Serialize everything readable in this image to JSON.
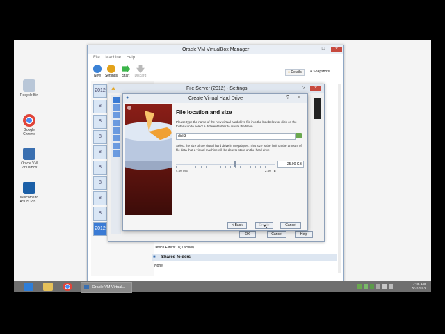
{
  "desktop": {
    "icons": [
      {
        "label_lines": [
          "Recycle Bin"
        ],
        "color": "#b9c7d8"
      },
      {
        "label_lines": [
          "Google",
          "Chrome"
        ],
        "color": "#e0453a"
      },
      {
        "label_lines": [
          "Oracle VM",
          "VirtualBox"
        ],
        "color": "#3a6fb0"
      },
      {
        "label_lines": [
          "Welcome to",
          "ASUS Pro..."
        ],
        "color": "#1b5fa7"
      }
    ]
  },
  "manager": {
    "title": "Oracle VM VirtualBox Manager",
    "menu": [
      "File",
      "Machine",
      "Help"
    ],
    "toolbar": [
      {
        "label": "New",
        "color": "#3b82d6"
      },
      {
        "label": "Settings",
        "color": "#e3a21a"
      },
      {
        "label": "Start",
        "color": "#3bb54a"
      },
      {
        "label": "Discard",
        "color": "#b9b9b9"
      }
    ],
    "details_button": "Details",
    "snapshots_button": "Snapshots",
    "vm_items": [
      "2012",
      "8",
      "8",
      "8",
      "8",
      "8",
      "8",
      "8",
      "8",
      "2012"
    ],
    "device_filters": "Device Filters:   0 (0 active)",
    "shared_folders_title": "Shared folders",
    "shared_folders_value": "None"
  },
  "settings": {
    "title": "File Server (2012) - Settings",
    "buttons": [
      "OK",
      "Cancel",
      "Help"
    ]
  },
  "vhd": {
    "title": "Create Virtual Hard Drive",
    "heading": "File location and size",
    "text1": "Please type the name of the new virtual hard drive file into the box below or click on the folder icon to select a different folder to create the file in.",
    "file_value": "disk3",
    "text2": "Select the size of the virtual hard drive in megabytes. This size is the limit on the amount of file data that a virtual machine will be able to store on the hard drive.",
    "size_value": "25.00 GB",
    "min_label": "4.00 MB",
    "max_label": "2.00 TB",
    "slider_fraction": 0.6,
    "back_label": "< Back",
    "create_label": "Create",
    "cancel_label": "Cancel"
  },
  "taskbar": {
    "task_label": "Oracle VM Virtual...",
    "time": "7:06 AM",
    "date": "5/2/2013"
  }
}
